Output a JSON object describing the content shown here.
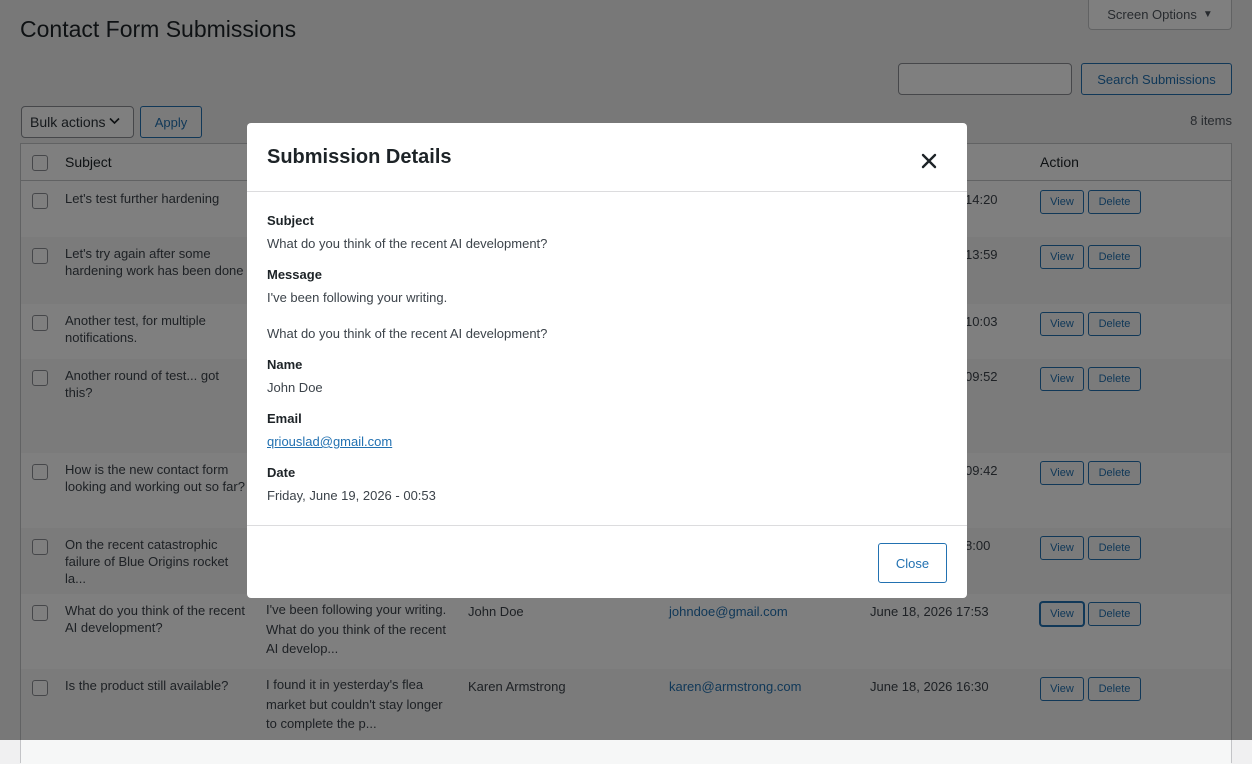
{
  "page": {
    "title": "Contact Form Submissions",
    "screen_options": "Screen Options"
  },
  "search": {
    "value": "",
    "button": "Search Submissions"
  },
  "bulk": {
    "selected": "Bulk actions",
    "apply": "Apply"
  },
  "item_count": "8 items",
  "table": {
    "headers": {
      "subject": "Subject",
      "action": "Action"
    },
    "rows": [
      {
        "subject": "Let's test further hardening",
        "message": "",
        "name": "",
        "email": "",
        "date": "14:20",
        "view": "View",
        "delete": "Delete"
      },
      {
        "subject": "Let's try again after some hardening work has been done",
        "message": "",
        "name": "",
        "email": "",
        "date": "13:59",
        "view": "View",
        "delete": "Delete"
      },
      {
        "subject": "Another test, for multiple notifications.",
        "message": "",
        "name": "",
        "email": "",
        "date": "10:03",
        "view": "View",
        "delete": "Delete"
      },
      {
        "subject": "Another round of test... got this?",
        "message": "",
        "name": "",
        "email": "",
        "date": "09:52",
        "view": "View",
        "delete": "Delete"
      },
      {
        "subject": "How is the new contact form looking and working out so far?",
        "message": "",
        "name": "",
        "email": "",
        "date": "09:42",
        "view": "View",
        "delete": "Delete"
      },
      {
        "subject": "On the recent catastrophic failure of Blue Origins rocket la...",
        "message": "",
        "name": "",
        "email": "",
        "date": "8:00",
        "view": "View",
        "delete": "Delete"
      },
      {
        "subject": "What do you think of the recent AI development?",
        "message": "I've been following your writing. What do you think of the recent AI develop...",
        "name": "John Doe",
        "email": "johndoe@gmail.com",
        "date": "June 18, 2026 17:53",
        "view": "View",
        "delete": "Delete"
      },
      {
        "subject": "Is the product still available?",
        "message": "I found it in yesterday's flea market but couldn't stay longer to complete the p...",
        "name": "Karen Armstrong",
        "email": "karen@armstrong.com",
        "date": "June 18, 2026 16:30",
        "view": "View",
        "delete": "Delete"
      }
    ]
  },
  "modal": {
    "title": "Submission Details",
    "subject_label": "Subject",
    "subject": "What do you think of the recent AI development?",
    "message_label": "Message",
    "message_line1": "I've been following your writing.",
    "message_line2": "What do you think of the recent AI development?",
    "name_label": "Name",
    "name": "John Doe",
    "email_label": "Email",
    "email": "qriouslad@gmail.com",
    "date_label": "Date",
    "date": "Friday, June 19, 2026 - 00:53",
    "close": "Close"
  },
  "colors": {
    "accent": "#2271b1",
    "overlay": "rgba(0,0,0,0.5)"
  }
}
